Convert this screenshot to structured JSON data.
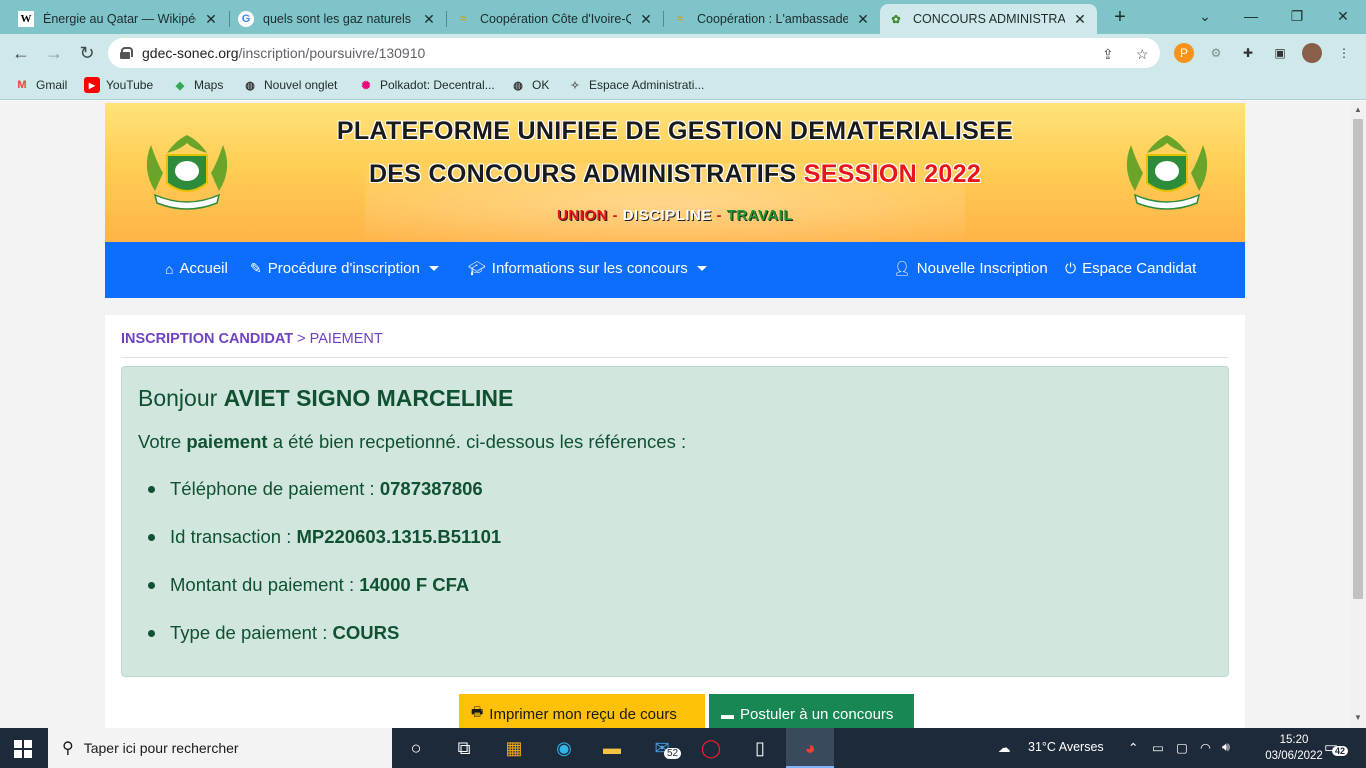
{
  "browser": {
    "tabs": [
      {
        "title": "Énergie au Qatar — Wikipédia",
        "favicon": "W"
      },
      {
        "title": "quels sont les gaz naturels - Google",
        "favicon": "G"
      },
      {
        "title": "Coopération Côte d'Ivoire-Qatar",
        "favicon": "≈"
      },
      {
        "title": "Coopération : L'ambassadeur",
        "favicon": "≈"
      },
      {
        "title": "CONCOURS ADMINISTRATIFS",
        "favicon": "✿"
      }
    ],
    "url_host": "gdec-sonec.org",
    "url_path": "/inscription/poursuivre/130910",
    "bookmarks": [
      "Gmail",
      "YouTube",
      "Maps",
      "Nouvel onglet",
      "Polkadot: Decentral...",
      "OK",
      "Espace Administrati..."
    ]
  },
  "banner": {
    "line1": "PLATEFORME UNIFIEE DE GESTION DEMATERIALISEE",
    "line2": "DES CONCOURS ADMINISTRATIFS",
    "session": "SESSION 2022",
    "motto_union": "UNION",
    "motto_discipline": "DISCIPLINE",
    "motto_travail": "TRAVAIL"
  },
  "nav": {
    "home": "Accueil",
    "procedure": "Procédure d'inscription",
    "info": "Informations sur les concours",
    "new_inscription": "Nouvelle Inscription",
    "candidate_space": "Espace Candidat"
  },
  "breadcrumb": {
    "part1": "INSCRIPTION CANDIDAT",
    "sep": ">",
    "part2": "PAIEMENT"
  },
  "confirmation": {
    "greeting": "Bonjour",
    "name": "AVIET SIGNO MARCELINE",
    "msg_prefix": "Votre",
    "msg_bold": "paiement",
    "msg_suffix": "a été bien recpetionné. ci-dessous les références :",
    "items": [
      {
        "label": "Téléphone de paiement :",
        "value": "0787387806"
      },
      {
        "label": "Id transaction :",
        "value": "MP220603.1315.B51101"
      },
      {
        "label": "Montant du paiement :",
        "value": "14000 F CFA"
      },
      {
        "label": "Type de paiement :",
        "value": "COURS"
      }
    ]
  },
  "buttons": {
    "print": "Imprimer mon reçu de cours",
    "apply": "Postuler à un concours"
  },
  "taskbar": {
    "search_placeholder": "Taper ici pour rechercher",
    "mail_badge": "52",
    "weather": "31°C  Averses",
    "time": "15:20",
    "date": "03/06/2022",
    "notifications": "42"
  },
  "colors": {
    "nav_blue": "#0d6efd",
    "alert_green_bg": "#d1e7dd",
    "alert_green_text": "#0f5132",
    "breadcrumb_purple": "#6f42c1",
    "session_red": "#e8161b",
    "btn_warning": "#ffc107",
    "btn_success": "#198754"
  }
}
